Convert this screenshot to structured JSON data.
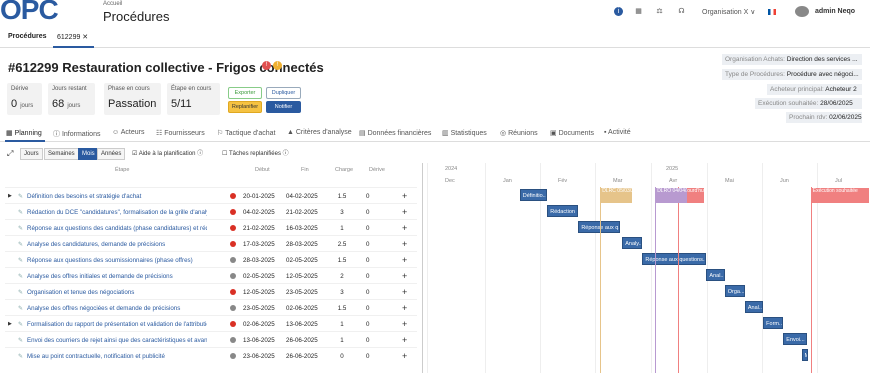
{
  "header": {
    "logo": "OPC",
    "breadcrumb": "Accueil",
    "title": "Procédures",
    "org": "Organisation X ∨",
    "user": "admin Neqo"
  },
  "tabs": [
    {
      "label": "Procédures"
    },
    {
      "label": "612299 ✕"
    }
  ],
  "project": {
    "title": "#612299 Restauration collective - Frigos connectés"
  },
  "kpis": [
    {
      "label": "Dérive",
      "value": "0",
      "unit": "jours"
    },
    {
      "label": "Jours restant",
      "value": "68",
      "unit": "jours"
    },
    {
      "label": "Phase en cours",
      "value": "Passation",
      "unit": ""
    },
    {
      "label": "Étape en cours",
      "value": "5/11",
      "unit": ""
    }
  ],
  "buttons": {
    "export": "Exporter",
    "duplicate": "Dupliquer",
    "replan": "Replanifier",
    "notify": "Notifier"
  },
  "info": [
    {
      "label": "Organisation Achats:",
      "value": "Direction des services ..."
    },
    {
      "label": "Type de Procédures:",
      "value": "Procédure avec négoci..."
    },
    {
      "label": "Acheteur principal:",
      "value": "Acheteur 2"
    },
    {
      "label": "Exécution souhaitée:",
      "value": "28/06/2025"
    },
    {
      "label": "Prochain rdv:",
      "value": "02/06/2025"
    }
  ],
  "nav": [
    "Planning",
    "Informations",
    "Acteurs",
    "Fournisseurs",
    "Tactique d'achat",
    "Critères d'analyse",
    "Données financières",
    "Statistiques",
    "Réunions",
    "Documents",
    "Activité"
  ],
  "controls": {
    "views": [
      "Jours",
      "Semaines",
      "Mois",
      "Années"
    ],
    "help": "Aide à la planification",
    "replanned": "Tâches replanifiées"
  },
  "columns": {
    "step": "Étape",
    "start": "Début",
    "end": "Fin",
    "charge": "Charge",
    "drift": "Dérive"
  },
  "rows": [
    {
      "name": "Définition des besoins et stratégie d'achat",
      "start": "20-01-2025",
      "end": "04-02-2025",
      "charge": "1.5",
      "drift": "0",
      "status": "red",
      "expand": true,
      "bar": "Définitio..."
    },
    {
      "name": "Rédaction du DCE \"candidatures\", formalisation de la grille d'analyse, st...",
      "start": "04-02-2025",
      "end": "21-02-2025",
      "charge": "3",
      "drift": "0",
      "status": "red",
      "expand": false,
      "bar": "Rédaction ..."
    },
    {
      "name": "Réponse aux questions des candidats (phase candidatures) et rédaction...",
      "start": "21-02-2025",
      "end": "16-03-2025",
      "charge": "1",
      "drift": "0",
      "status": "red",
      "expand": false,
      "bar": "Réponse aux q..."
    },
    {
      "name": "Analyse des candidatures, demande de précisions",
      "start": "17-03-2025",
      "end": "28-03-2025",
      "charge": "2.5",
      "drift": "0",
      "status": "red",
      "expand": false,
      "bar": "Analy..."
    },
    {
      "name": "Réponse aux questions des soumissionnaires (phase offres)",
      "start": "28-03-2025",
      "end": "02-05-2025",
      "charge": "1.5",
      "drift": "0",
      "status": "grey",
      "expand": false,
      "bar": "Réponse aux questions..."
    },
    {
      "name": "Analyse des offres initiales et demande de précisions",
      "start": "02-05-2025",
      "end": "12-05-2025",
      "charge": "2",
      "drift": "0",
      "status": "grey",
      "expand": false,
      "bar": "Anal..."
    },
    {
      "name": "Organisation et tenue des négociations",
      "start": "12-05-2025",
      "end": "23-05-2025",
      "charge": "3",
      "drift": "0",
      "status": "red",
      "expand": false,
      "bar": "Orga..."
    },
    {
      "name": "Analyse des offres négociées et demande de précisions",
      "start": "23-05-2025",
      "end": "02-06-2025",
      "charge": "1.5",
      "drift": "0",
      "status": "grey",
      "expand": false,
      "bar": "Anal..."
    },
    {
      "name": "Formalisation du rapport de présentation et validation de l'attribution",
      "start": "02-06-2025",
      "end": "13-06-2025",
      "charge": "1",
      "drift": "0",
      "status": "red",
      "expand": true,
      "bar": "Form..."
    },
    {
      "name": "Envoi des courriers de rejet ainsi que des caractéristiques et avantages ...",
      "start": "13-06-2025",
      "end": "26-06-2025",
      "charge": "1",
      "drift": "0",
      "status": "grey",
      "expand": false,
      "bar": "Envoi..."
    },
    {
      "name": "Mise au point contractuelle, notification et publicité",
      "start": "23-06-2025",
      "end": "26-06-2025",
      "charge": "0",
      "drift": "0",
      "status": "grey",
      "expand": false,
      "bar": "M"
    }
  ],
  "gantt": {
    "years": [
      "2024",
      "2025"
    ],
    "months": [
      "Dec",
      "Jan",
      "Fév",
      "Mar",
      "Avr",
      "Mai",
      "Jun",
      "Jul"
    ],
    "milestones": [
      {
        "label": "DLRC 05/03/2025",
        "color": "#e6c48a"
      },
      {
        "label": "Aujourd'hui",
        "color": "#f08080"
      },
      {
        "label": "DLRO 04/04/2025",
        "color": "#b89ad0"
      },
      {
        "label": "Exécution souhaitée",
        "color": "#f08080"
      }
    ]
  },
  "colors": {
    "accent": "#2a5aa0",
    "red": "#d93025",
    "grey": "#888888",
    "replan": "#f5c242"
  }
}
